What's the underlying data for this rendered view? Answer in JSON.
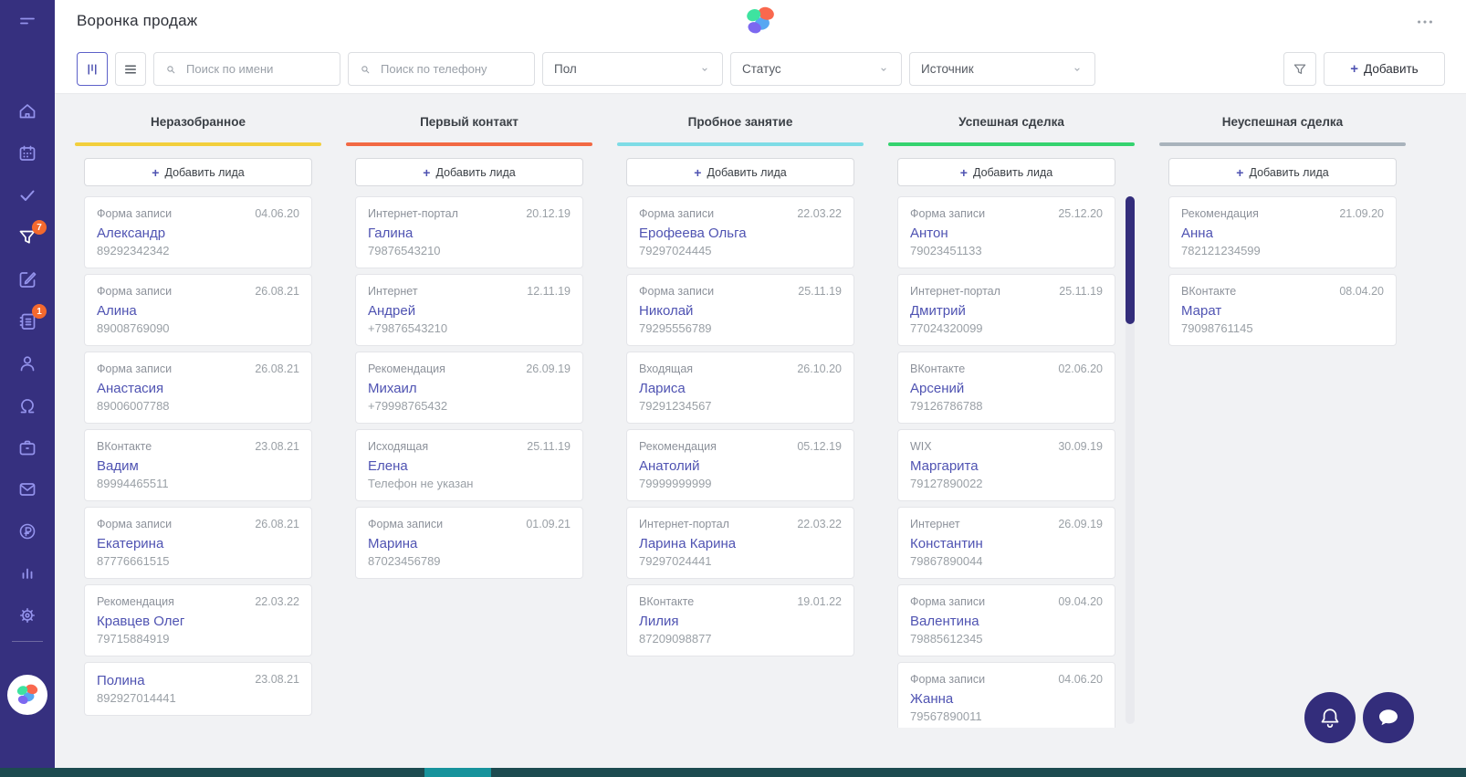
{
  "page": {
    "title": "Воронка продаж"
  },
  "toolbar": {
    "search_name_placeholder": "Поиск по имени",
    "search_phone_placeholder": "Поиск по телефону",
    "gender_filter_label": "Пол",
    "status_filter_label": "Статус",
    "source_filter_label": "Источник",
    "add_button_label": "Добавить"
  },
  "icons": {
    "plus": "+"
  },
  "sidebar": {
    "funnel_badge_count": "7",
    "notebook_badge_count": "1"
  },
  "colors": {
    "accent": "#4F53B2",
    "sidebar_bg": "#36307F",
    "badge_orange": "#F4692E",
    "scrollbar_thumb": "#332D7B",
    "bottom_bar": "#1D4B50",
    "bottom_bar_thumb": "#17939C"
  },
  "board": {
    "add_lead_label": "Добавить лида",
    "columns": [
      {
        "title": "Неразобранное",
        "color": "#F2CF3C",
        "cards": [
          {
            "source": "Форма записи",
            "date": "04.06.20",
            "name": "Александр",
            "phone": "89292342342"
          },
          {
            "source": "Форма записи",
            "date": "26.08.21",
            "name": "Алина",
            "phone": "89008769090"
          },
          {
            "source": "Форма записи",
            "date": "26.08.21",
            "name": "Анастасия",
            "phone": "89006007788"
          },
          {
            "source": "ВКонтакте",
            "date": "23.08.21",
            "name": "Вадим",
            "phone": "89994465511"
          },
          {
            "source": "Форма записи",
            "date": "26.08.21",
            "name": "Екатерина",
            "phone": "87776661515"
          },
          {
            "source": "Рекомендация",
            "date": "22.03.22",
            "name": "Кравцев Олег",
            "phone": "79715884919"
          },
          {
            "source": "",
            "date": "23.08.21",
            "name": "Полина",
            "phone": "892927014441"
          }
        ]
      },
      {
        "title": "Первый контакт",
        "color": "#F26944",
        "cards": [
          {
            "source": "Интернет-портал",
            "date": "20.12.19",
            "name": "Галина",
            "phone": "79876543210"
          },
          {
            "source": "Интернет",
            "date": "12.11.19",
            "name": "Андрей",
            "phone": "+79876543210"
          },
          {
            "source": "Рекомендация",
            "date": "26.09.19",
            "name": "Михаил",
            "phone": "+79998765432"
          },
          {
            "source": "Исходящая",
            "date": "25.11.19",
            "name": "Елена",
            "phone": "Телефон не указан"
          },
          {
            "source": "Форма записи",
            "date": "01.09.21",
            "name": "Марина",
            "phone": "87023456789"
          }
        ]
      },
      {
        "title": "Пробное занятие",
        "color": "#7EDCE6",
        "cards": [
          {
            "source": "Форма записи",
            "date": "22.03.22",
            "name": "Ерофеева Ольга",
            "phone": "79297024445"
          },
          {
            "source": "Форма записи",
            "date": "25.11.19",
            "name": "Николай",
            "phone": "79295556789"
          },
          {
            "source": "Входящая",
            "date": "26.10.20",
            "name": "Лариса",
            "phone": "79291234567"
          },
          {
            "source": "Рекомендация",
            "date": "05.12.19",
            "name": "Анатолий",
            "phone": "79999999999"
          },
          {
            "source": "Интернет-портал",
            "date": "22.03.22",
            "name": "Ларина Карина",
            "phone": "79297024441"
          },
          {
            "source": "ВКонтакте",
            "date": "19.01.22",
            "name": "Лилия",
            "phone": "87209098877"
          }
        ]
      },
      {
        "title": "Успешная сделка",
        "color": "#35D36F",
        "has_scrollbar": true,
        "cards": [
          {
            "source": "Форма записи",
            "date": "25.12.20",
            "name": "Антон",
            "phone": "79023451133"
          },
          {
            "source": "Интернет-портал",
            "date": "25.11.19",
            "name": "Дмитрий",
            "phone": "77024320099"
          },
          {
            "source": "ВКонтакте",
            "date": "02.06.20",
            "name": "Арсений",
            "phone": "79126786788"
          },
          {
            "source": "WIX",
            "date": "30.09.19",
            "name": "Маргарита",
            "phone": "79127890022"
          },
          {
            "source": "Интернет",
            "date": "26.09.19",
            "name": "Константин",
            "phone": "79867890044"
          },
          {
            "source": "Форма записи",
            "date": "09.04.20",
            "name": "Валентина",
            "phone": "79885612345"
          },
          {
            "source": "Форма записи",
            "date": "04.06.20",
            "name": "Жанна",
            "phone": "79567890011"
          }
        ]
      },
      {
        "title": "Неуспешная сделка",
        "color": "#A9B3BC",
        "cards": [
          {
            "source": "Рекомендация",
            "date": "21.09.20",
            "name": "Анна",
            "phone": "782121234599"
          },
          {
            "source": "ВКонтакте",
            "date": "08.04.20",
            "name": "Марат",
            "phone": "79098761145"
          }
        ]
      }
    ]
  }
}
